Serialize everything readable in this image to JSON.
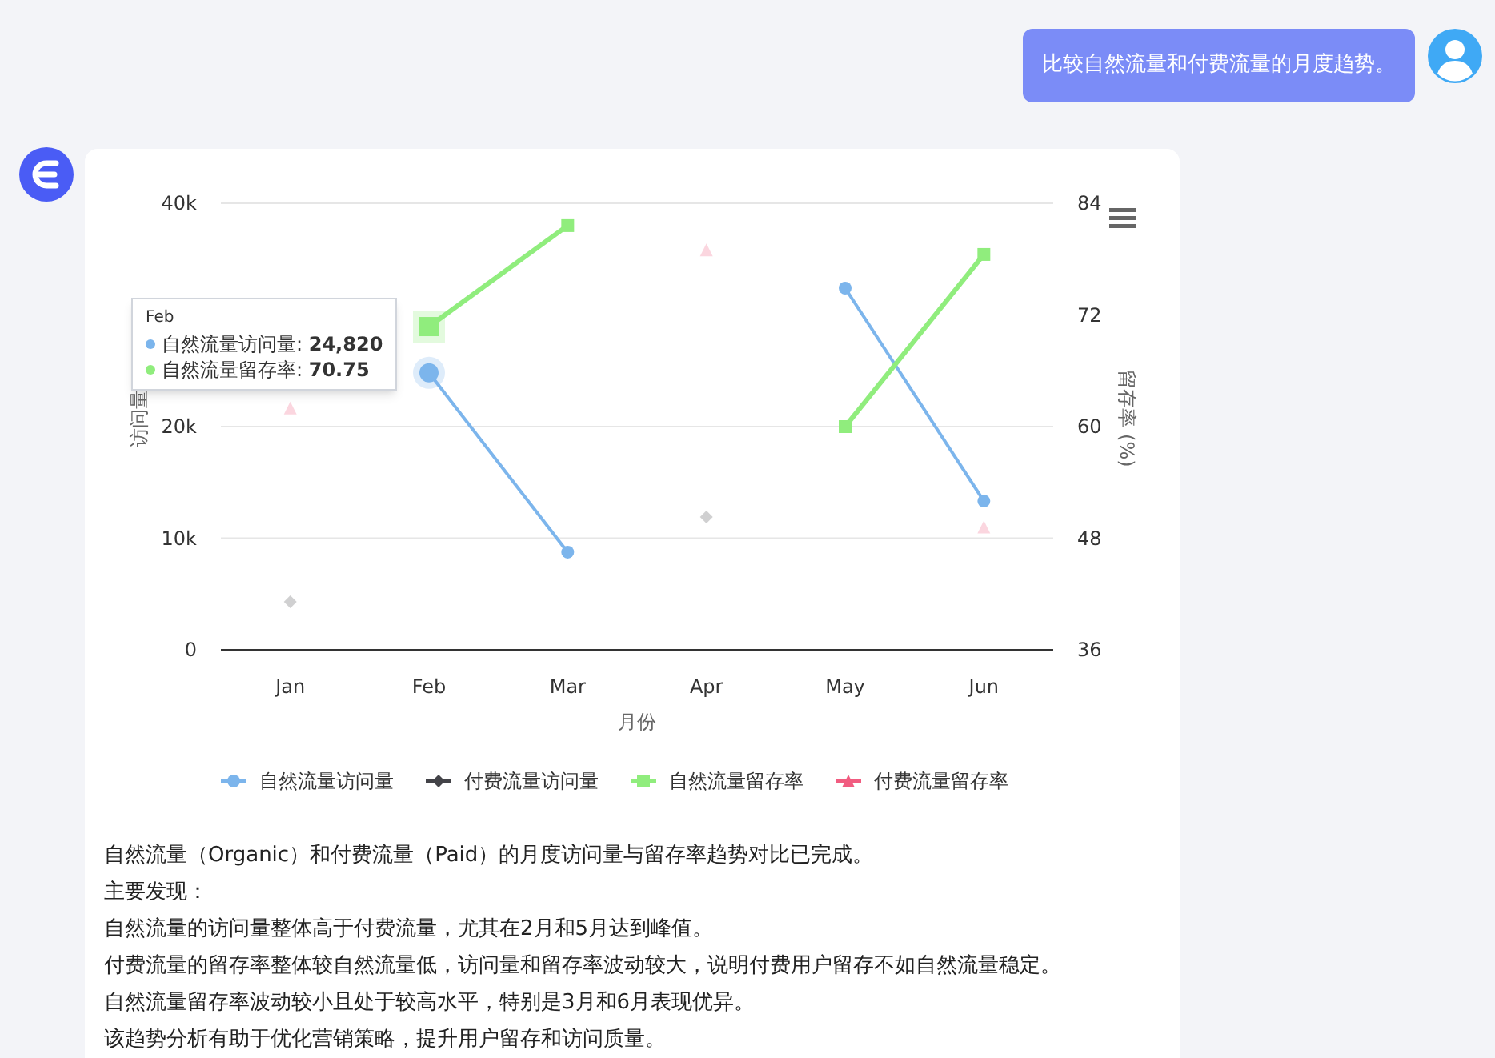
{
  "user_message": {
    "text": "比较自然流量和付费流量的月度趋势。"
  },
  "chart": {
    "chart_data": {
      "type": "line",
      "xlabel": "月份",
      "ylabel": "访问量",
      "y2label": "留存率 (%)",
      "categories": [
        "Jan",
        "Feb",
        "Mar",
        "Apr",
        "May",
        "Jun"
      ],
      "ylim": [
        0,
        40000
      ],
      "yticks": [
        0,
        {
          "value": 10000,
          "label": "10k"
        },
        {
          "value": 20000,
          "label": "20k"
        },
        {
          "value": 40000,
          "label": "40k"
        }
      ],
      "y2lim": [
        36,
        84
      ],
      "y2ticks": [
        36,
        48,
        60,
        72,
        84
      ],
      "series": [
        {
          "name": "自然流量访问量",
          "color": "#7cb5ec",
          "type": "line",
          "marker": "circle",
          "values": [
            null,
            24820,
            8750,
            null,
            32400,
            13330
          ]
        },
        {
          "name": "付费流量访问量",
          "color": "#434348",
          "type": "scatter",
          "marker": "diamond",
          "values": [
            4300,
            null,
            null,
            11900,
            null,
            null
          ]
        },
        {
          "name": "自然流量留存率",
          "color": "#90ed7d",
          "type": "line",
          "marker": "square",
          "axis": "y2",
          "values": [
            null,
            70.75,
            81.6,
            null,
            60,
            78.5
          ]
        },
        {
          "name": "付费流量留存率",
          "color": "#f15c80",
          "type": "scatter",
          "marker": "triangle",
          "axis": "y2",
          "values": [
            62,
            null,
            null,
            79,
            null,
            49.2
          ]
        }
      ]
    },
    "tooltip": {
      "title": "Feb",
      "items": [
        {
          "color": "#7cb5ec",
          "label": "自然流量访问量: ",
          "value": "24,820"
        },
        {
          "color": "#90ed7d",
          "label": "自然流量留存率: ",
          "value": "70.75"
        }
      ]
    }
  },
  "summary": [
    "自然流量（Organic）和付费流量（Paid）的月度访问量与留存率趋势对比已完成。",
    "主要发现：",
    "自然流量的访问量整体高于付费流量，尤其在2月和5月达到峰值。",
    "付费流量的留存率整体较自然流量低，访问量和留存率波动较大，说明付费用户留存不如自然流量稳定。",
    "自然流量留存率波动较小且处于较高水平，特别是3月和6月表现优异。",
    "该趋势分析有助于优化营销策略，提升用户留存和访问质量。"
  ]
}
